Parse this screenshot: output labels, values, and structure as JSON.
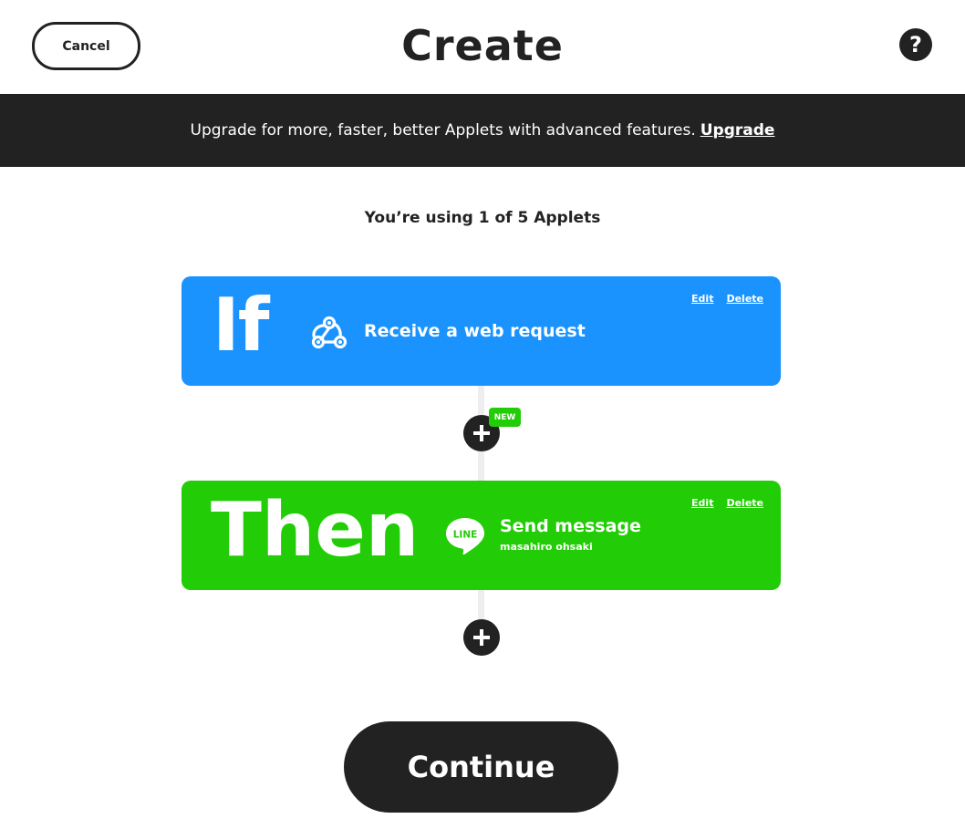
{
  "header": {
    "cancel_label": "Cancel",
    "title": "Create",
    "help_label": "?"
  },
  "banner": {
    "text": "Upgrade for more, faster, better Applets with advanced features.",
    "link_label": "Upgrade"
  },
  "usage_text": "You’re using 1 of 5 Applets",
  "trigger": {
    "keyword": "If",
    "service_icon": "webhook-icon",
    "title": "Receive a web request",
    "edit_label": "Edit",
    "delete_label": "Delete",
    "color": "#1a93ff"
  },
  "action": {
    "keyword": "Then",
    "service_icon": "line-icon",
    "icon_text": "LINE",
    "title": "Send message",
    "subtitle": "masahiro ohsaki",
    "edit_label": "Edit",
    "delete_label": "Delete",
    "color": "#22cc06"
  },
  "new_badge": "NEW",
  "continue_label": "Continue"
}
